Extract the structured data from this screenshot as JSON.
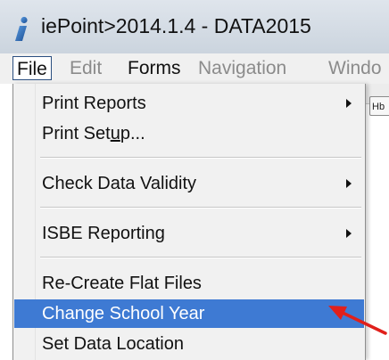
{
  "window": {
    "title": "iePoint>2014.1.4 - DATA2015",
    "app_icon": "info-i-icon"
  },
  "menubar": {
    "items": [
      {
        "label": "File",
        "state": "active"
      },
      {
        "label": "Edit",
        "state": "disabled"
      },
      {
        "label": "Forms",
        "state": "enabled"
      },
      {
        "label": "Navigation",
        "state": "disabled"
      },
      {
        "label": "Windo",
        "state": "disabled"
      }
    ]
  },
  "background_tab": {
    "label": "Hb"
  },
  "file_menu": {
    "items": [
      {
        "label": "Print Reports",
        "submenu": true
      },
      {
        "label_before": "Print Set",
        "label_underline": "u",
        "label_after": "p...",
        "submenu": false
      },
      {
        "label": "Check Data Validity",
        "submenu": true
      },
      {
        "label": "ISBE Reporting",
        "submenu": true
      },
      {
        "label": "Re-Create Flat Files",
        "submenu": false
      },
      {
        "label": "Change School Year",
        "submenu": false,
        "highlighted": true
      },
      {
        "label": "Set Data Location",
        "submenu": false
      }
    ]
  },
  "annotation": {
    "arrow_color": "#e0201b",
    "points_to": "Change School Year"
  },
  "colors": {
    "highlight": "#3e7ad3",
    "menu_background": "#f1f1f1",
    "disabled_text": "#8b8b8b"
  }
}
